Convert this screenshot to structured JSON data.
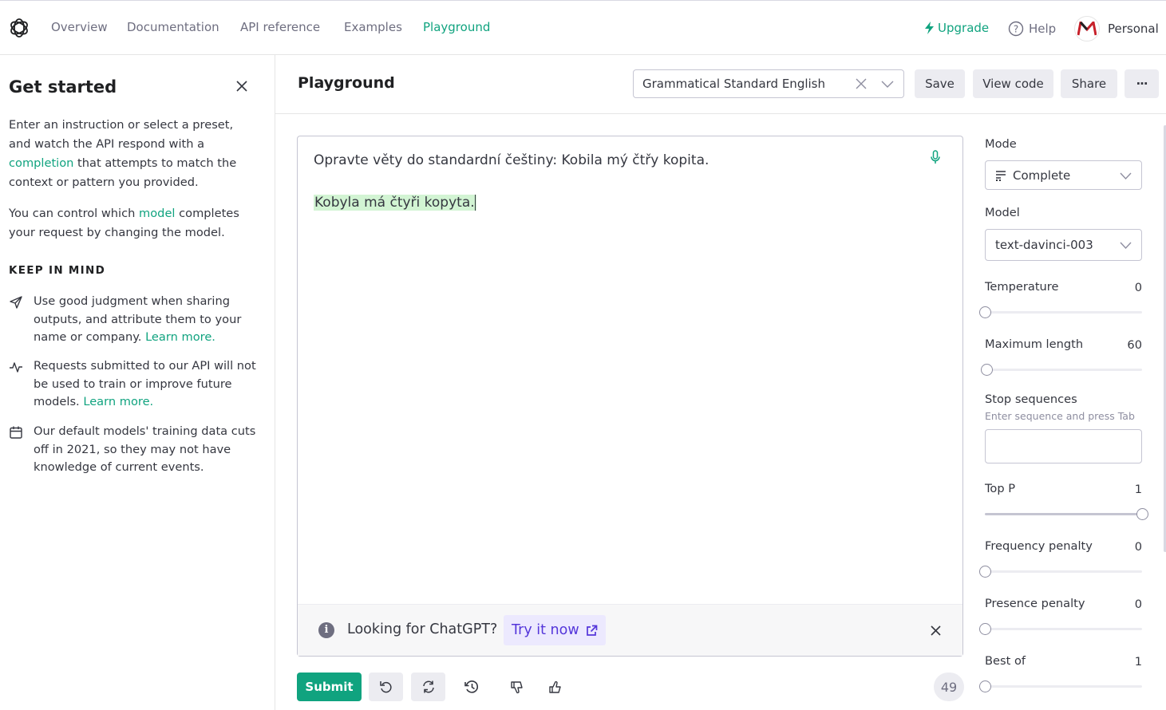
{
  "nav": {
    "links": [
      "Overview",
      "Documentation",
      "API reference",
      "Examples",
      "Playground"
    ],
    "upgrade": "Upgrade",
    "help": "Help",
    "account": "Personal"
  },
  "sidebar": {
    "title": "Get started",
    "intro_pre": "Enter an instruction or select a preset, and watch the API respond with a ",
    "intro_link": "completion",
    "intro_post": " that attempts to match the context or pattern you provided.",
    "model_pre": "You can control which ",
    "model_link": "model",
    "model_post": " completes your request by changing the model.",
    "keep_in_mind": "KEEP IN MIND",
    "tip1": "Use good judgment when sharing outputs, and attribute them to your name or company.",
    "tip1_link": "Learn more.",
    "tip2": "Requests submitted to our API will not be used to train or improve future models.",
    "tip2_link": "Learn more.",
    "tip3": "Our default models' training data cuts off in 2021, so they may not have knowledge of current events."
  },
  "header": {
    "title": "Playground",
    "preset": "Grammatical Standard English",
    "save": "Save",
    "view_code": "View code",
    "share": "Share",
    "more": "···"
  },
  "editor": {
    "prompt": "Opravte věty do standardní češtiny: Kobila mý čtřy kopita.",
    "completion": "Kobyla má čtyři kopyta.",
    "banner_text": "Looking for ChatGPT?",
    "banner_link": "Try it now"
  },
  "toolbar": {
    "submit": "Submit",
    "token_count": "49"
  },
  "settings": {
    "mode_label": "Mode",
    "mode_value": "Complete",
    "model_label": "Model",
    "model_value": "text-davinci-003",
    "temperature_label": "Temperature",
    "temperature_value": "0",
    "temperature_fill": 0,
    "max_length_label": "Maximum length",
    "max_length_value": "60",
    "max_length_fill": 0.015,
    "stop_label": "Stop sequences",
    "stop_hint": "Enter sequence and press Tab",
    "top_p_label": "Top P",
    "top_p_value": "1",
    "top_p_fill": 1,
    "freq_label": "Frequency penalty",
    "freq_value": "0",
    "freq_fill": 0,
    "presence_label": "Presence penalty",
    "presence_value": "0",
    "presence_fill": 0,
    "best_of_label": "Best of",
    "best_of_value": "1",
    "best_of_fill": 0
  },
  "colors": {
    "accent": "#10a37f",
    "highlight": "#d2f4d3",
    "link_purple": "#5436da"
  }
}
